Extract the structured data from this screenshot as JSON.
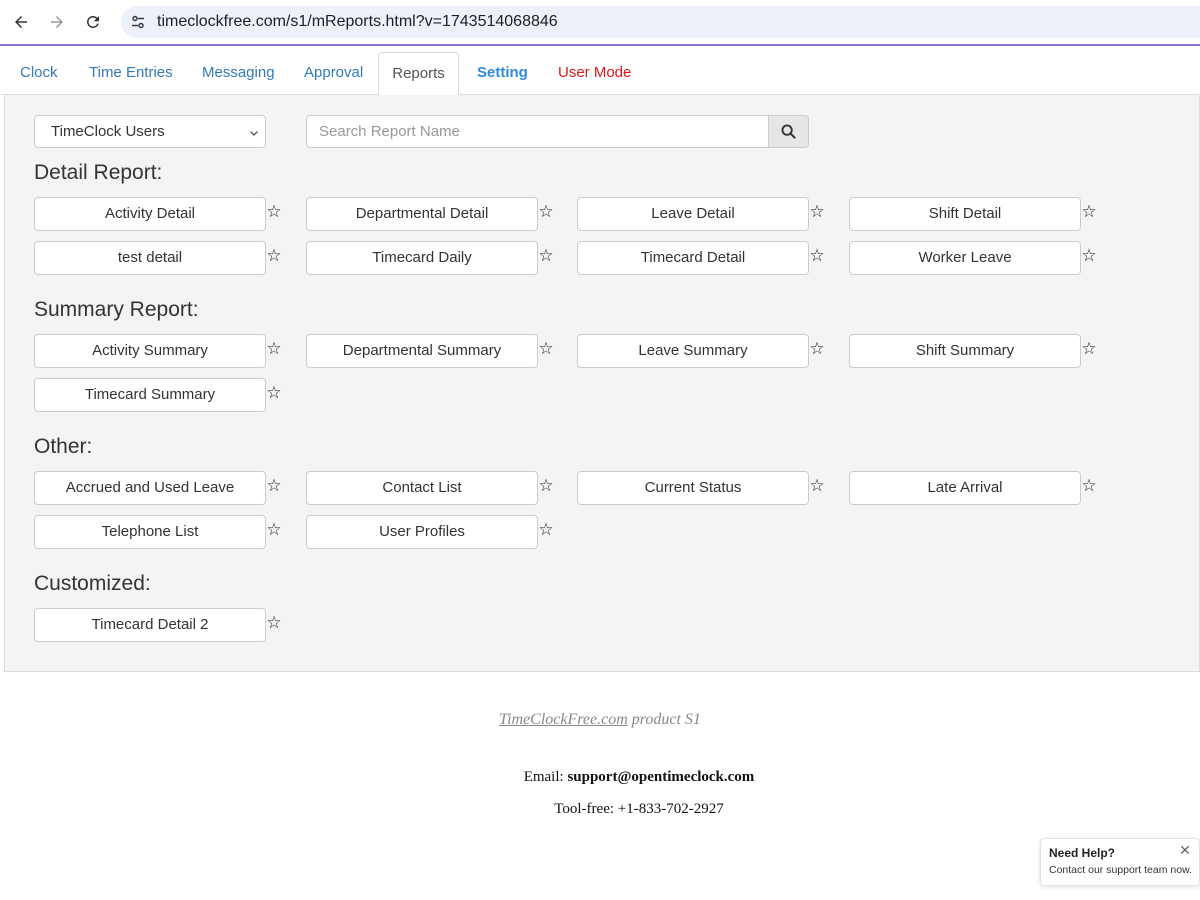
{
  "browser": {
    "back_icon": "arrow-left-icon",
    "forward_icon": "arrow-right-icon",
    "reload_icon": "reload-icon",
    "site_info_icon": "tune-icon",
    "url": "timeclockfree.com/s1/mReports.html?v=1743514068846"
  },
  "tabs": [
    {
      "label": "Clock"
    },
    {
      "label": "Time Entries"
    },
    {
      "label": "Messaging"
    },
    {
      "label": "Approval"
    },
    {
      "label": "Reports",
      "active": true
    },
    {
      "label": "Setting"
    },
    {
      "label": "User Mode"
    }
  ],
  "filters": {
    "user_select": "TimeClock Users",
    "search_placeholder": "Search Report Name"
  },
  "sections": [
    {
      "title": "Detail Report:",
      "reports": [
        "Activity Detail",
        "Departmental Detail",
        "Leave Detail",
        "Shift Detail",
        "test detail",
        "Timecard Daily",
        "Timecard Detail",
        "Worker Leave"
      ]
    },
    {
      "title": "Summary Report:",
      "reports": [
        "Activity Summary",
        "Departmental Summary",
        "Leave Summary",
        "Shift Summary",
        "Timecard Summary"
      ]
    },
    {
      "title": "Other:",
      "reports": [
        "Accrued and Used Leave",
        "Contact List",
        "Current Status",
        "Late Arrival",
        "Telephone List",
        "User Profiles"
      ]
    },
    {
      "title": "Customized:",
      "reports": [
        "Timecard Detail 2"
      ]
    }
  ],
  "star_glyph": "☆",
  "footer": {
    "product_link": "TimeClockFree.com",
    "product_suffix": " product S1",
    "email_label": "Email: ",
    "email": "support@opentimeclock.com",
    "phone_label": "Tool-free: ",
    "phone": "+1-833-702-2927"
  },
  "help_widget": {
    "title": "Need Help?",
    "subtitle": "Contact our support team now.",
    "close_glyph": "✕"
  },
  "colors": {
    "link": "#337ab7",
    "setting": "#2f8ae0",
    "user_mode": "#e01818",
    "panel_bg": "#f4f4f4",
    "accent_line": "#8e6fd1"
  }
}
